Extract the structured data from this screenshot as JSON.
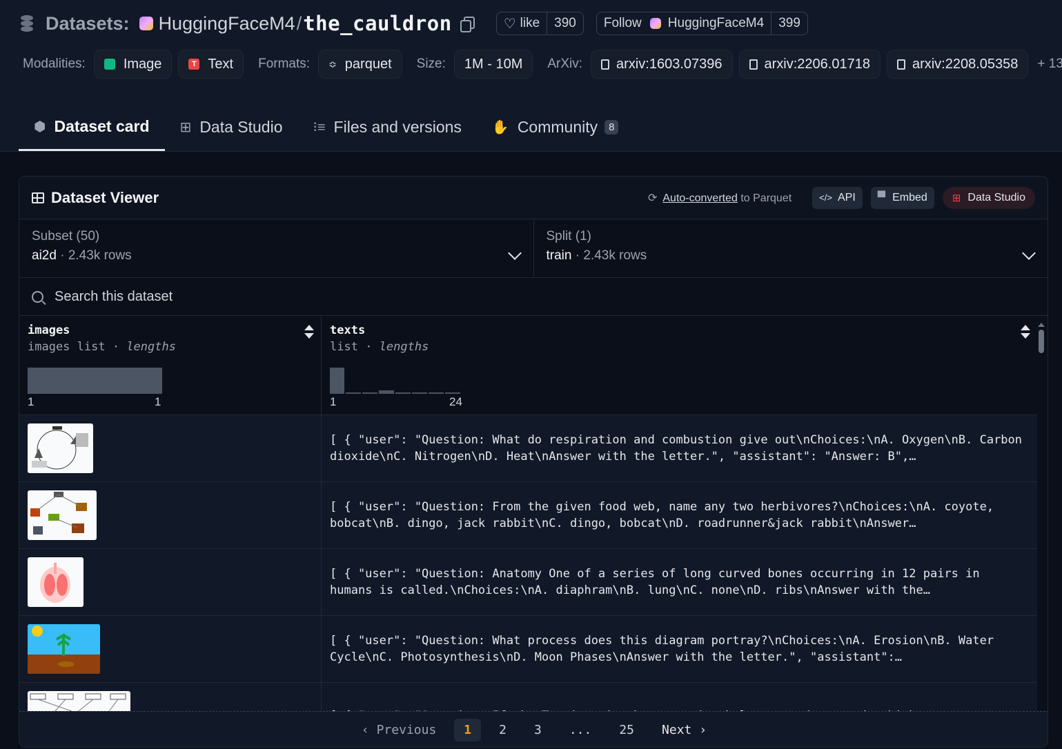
{
  "header": {
    "title_label": "Datasets:",
    "org": "HuggingFaceM4",
    "separator": "/",
    "repo": "the_cauldron",
    "like_label": "like",
    "like_count": "390",
    "follow_label": "Follow",
    "follow_org": "HuggingFaceM4",
    "follow_count": "399"
  },
  "meta": {
    "modalities_label": "Modalities:",
    "modalities": [
      "Image",
      "Text"
    ],
    "formats_label": "Formats:",
    "format": "parquet",
    "size_label": "Size:",
    "size": "1M - 10M",
    "arxiv_label": "ArXiv:",
    "arxiv": [
      "arxiv:1603.07396",
      "arxiv:2206.01718",
      "arxiv:2208.05358"
    ],
    "more": "+ 13"
  },
  "tabs": [
    {
      "label": "Dataset card",
      "active": true
    },
    {
      "label": "Data Studio"
    },
    {
      "label": "Files and versions"
    },
    {
      "label": "Community",
      "badge": "8"
    }
  ],
  "viewer": {
    "title": "Dataset Viewer",
    "auto_converted": "Auto-converted",
    "to_parquet": " to Parquet",
    "api": "API",
    "embed": "Embed",
    "data_studio": "Data Studio",
    "subset_label": "Subset (50)",
    "subset_value": "ai2d",
    "subset_rows": "2.43k rows",
    "split_label": "Split (1)",
    "split_value": "train",
    "split_rows": "2.43k rows",
    "search_placeholder": "Search this dataset"
  },
  "table": {
    "col1": {
      "name": "images",
      "type": "images list",
      "sub": "lengths",
      "hist_min": "1",
      "hist_max": "1"
    },
    "col2": {
      "name": "texts",
      "type": "list",
      "sub": "lengths",
      "hist_min": "1",
      "hist_max": "24"
    },
    "rows": [
      "[ { \"user\": \"Question: What do respiration and combustion give out\\nChoices:\\nA. Oxygen\\nB. Carbon dioxide\\nC. Nitrogen\\nD. Heat\\nAnswer with the letter.\", \"assistant\": \"Answer: B\",…",
      "[ { \"user\": \"Question: From the given food web, name any two herbivores?\\nChoices:\\nA. coyote, bobcat\\nB. dingo, jack rabbit\\nC. dingo, bobcat\\nD. roadrunner&jack rabbit\\nAnswer…",
      "[ { \"user\": \"Question: Anatomy One of a series of long curved bones occurring in 12 pairs in humans is called.\\nChoices:\\nA. diaphram\\nB. lung\\nC. none\\nD. ribs\\nAnswer with the…",
      "[ { \"user\": \"Question: What process does this diagram portray?\\nChoices:\\nA. Erosion\\nB. Water Cycle\\nC. Photosynthesis\\nD. Moon Phases\\nAnswer with the letter.\", \"assistant\":…",
      "[ { \"user\": \"Question: If the Termites in the community below were destroyed, which"
    ]
  },
  "pager": {
    "previous": "Previous",
    "pages": [
      "1",
      "2",
      "3",
      "...",
      "25"
    ],
    "next": "Next"
  }
}
